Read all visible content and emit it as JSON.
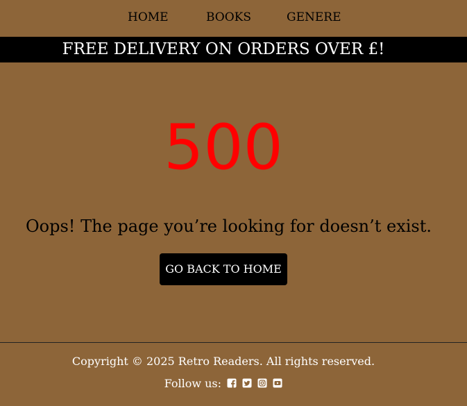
{
  "nav": {
    "items": [
      {
        "label": "HOME"
      },
      {
        "label": "BOOKS"
      },
      {
        "label": "GENERE"
      }
    ]
  },
  "banner": {
    "text": "FREE DELIVERY ON ORDERS OVER £!"
  },
  "error": {
    "code": "500",
    "message": "Oops! The page you’re looking for doesn’t exist.",
    "button_label": "GO BACK TO HOME"
  },
  "footer": {
    "copyright": "Copyright © 2025 Retro Readers. All rights reserved.",
    "follow_label": "Follow us:",
    "social_icons": [
      "facebook-square-icon",
      "twitter-square-icon",
      "instagram-square-icon",
      "youtube-square-icon"
    ]
  },
  "colors": {
    "background": "#8d6539",
    "banner": "#000000",
    "error_code": "#ff0000",
    "button": "#000000",
    "light_text": "#ffffff"
  }
}
